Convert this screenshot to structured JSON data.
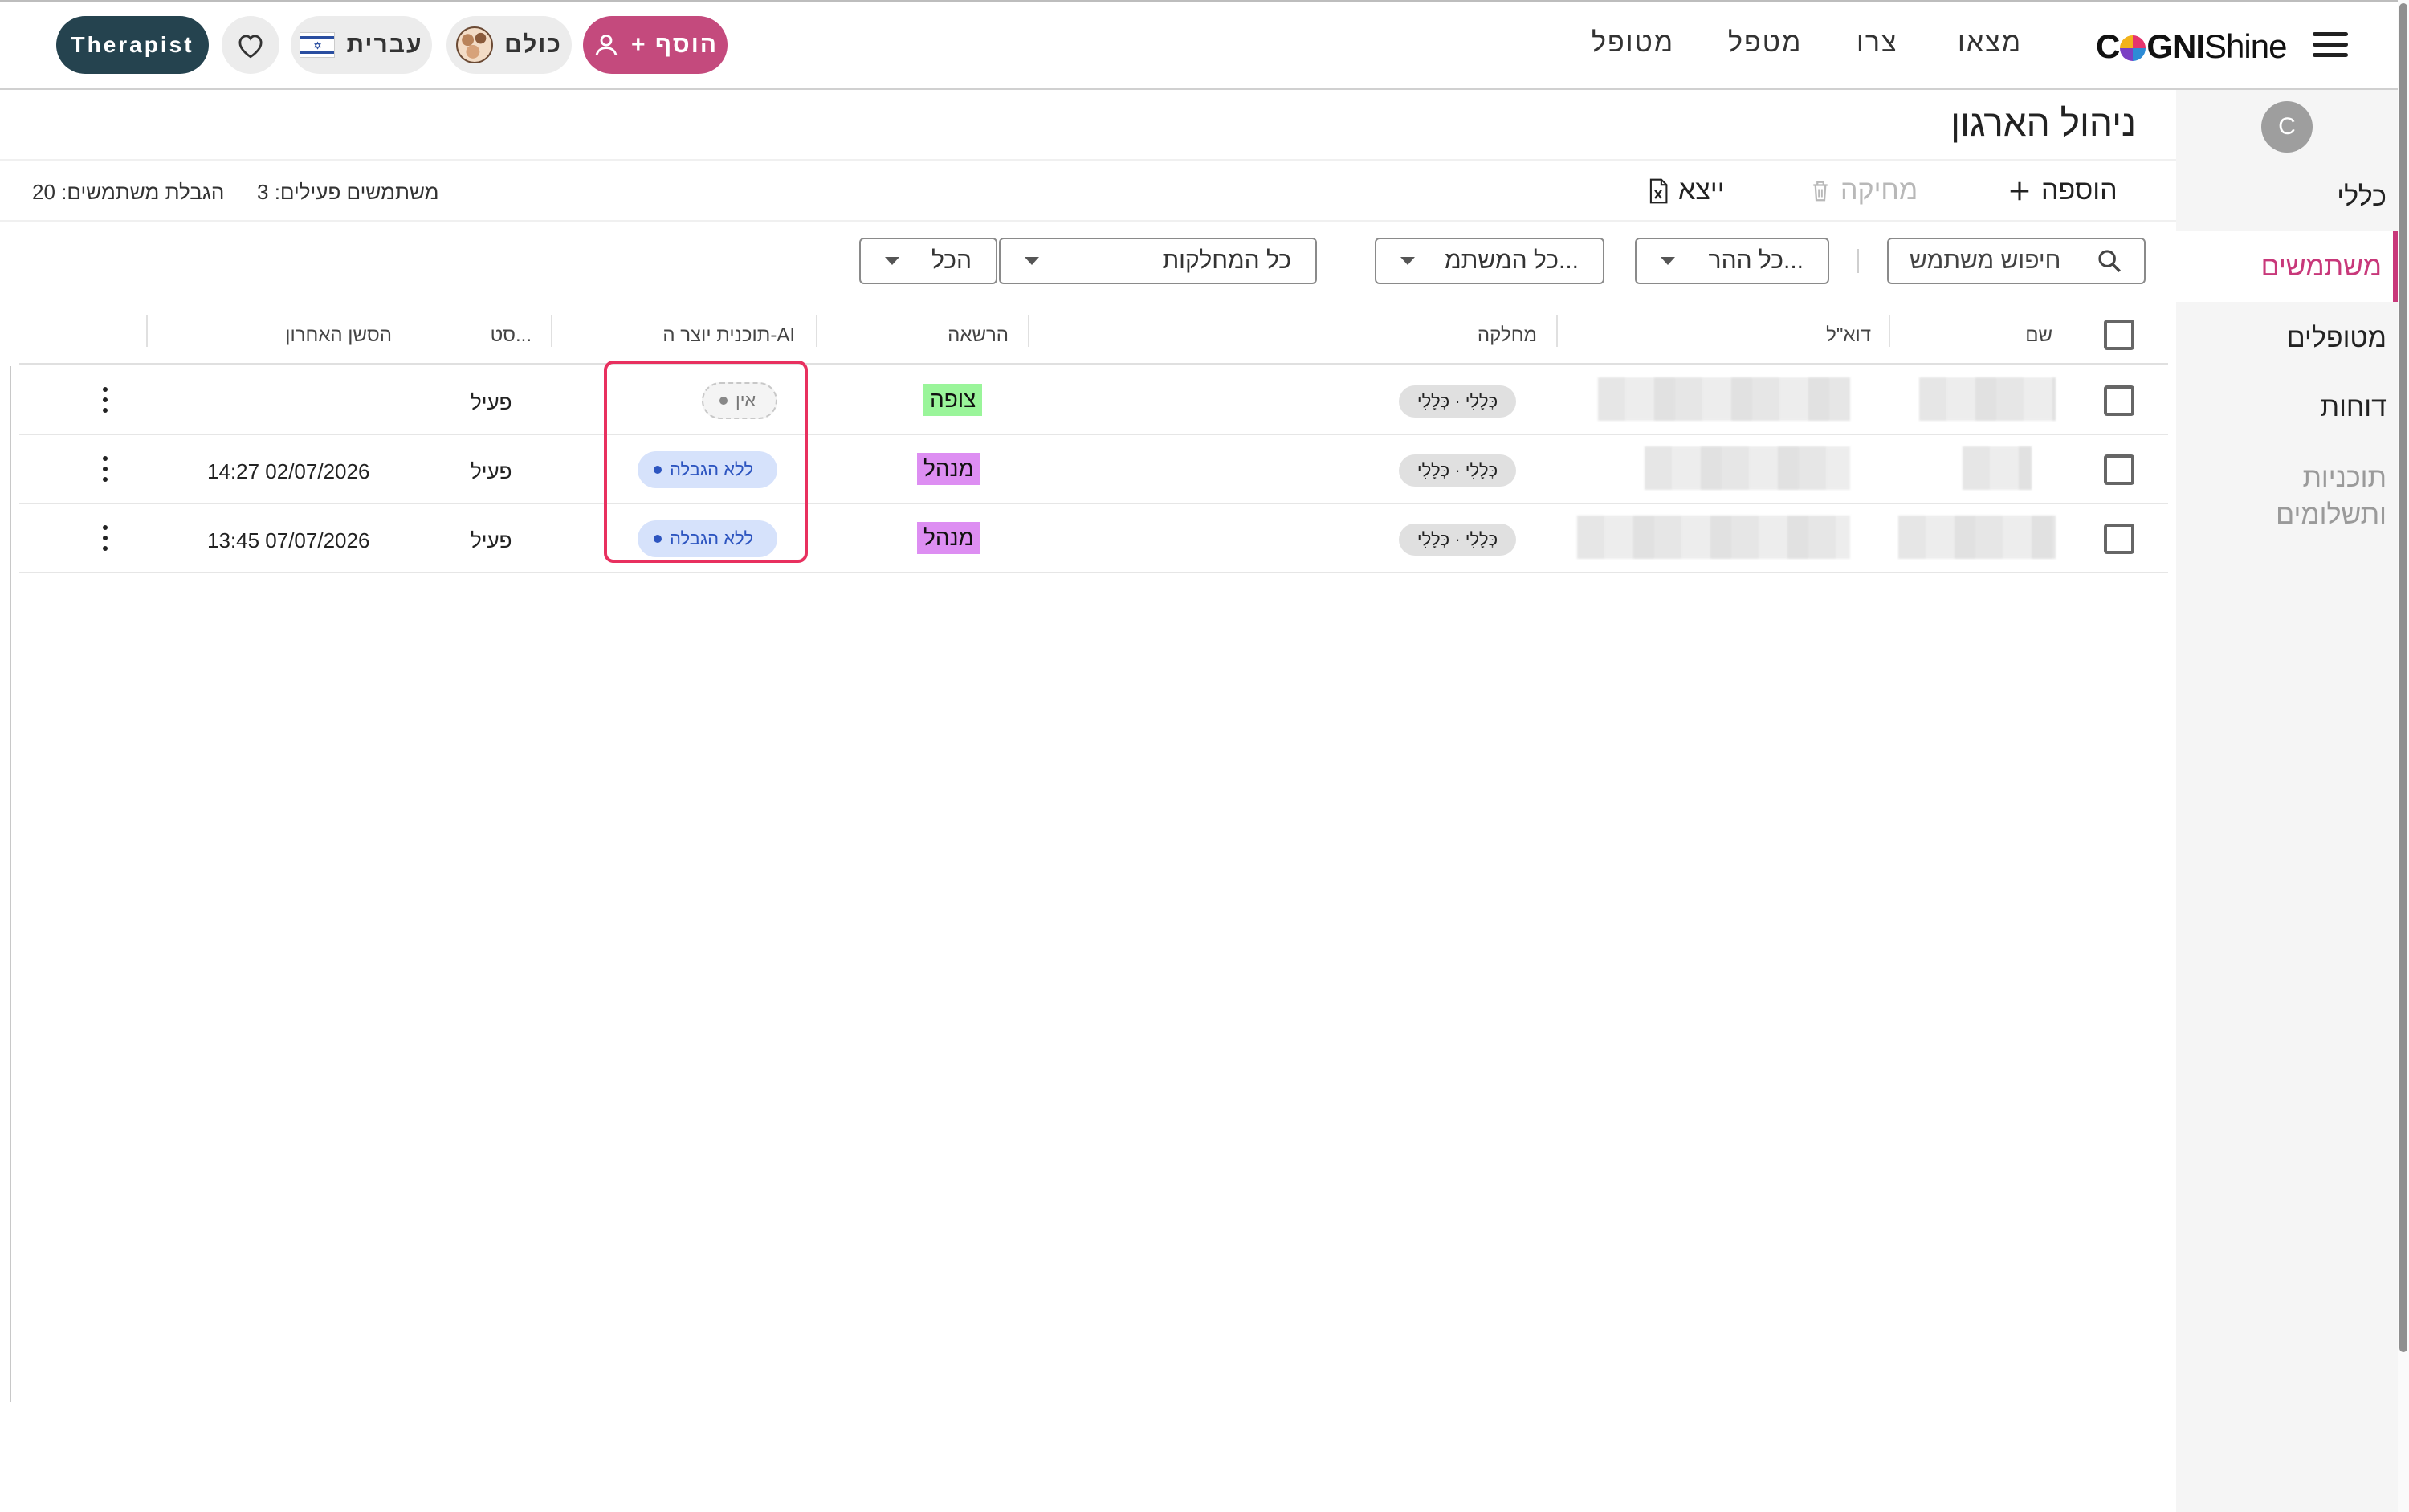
{
  "topbar": {
    "logo_bold": "CGNI",
    "logo_light": "Shine",
    "nav": [
      "מצאו",
      "צרו",
      "מטפל",
      "מטופל"
    ],
    "add_label": "+ הוסף",
    "everyone_label": "כולם",
    "language_label": "עברית",
    "role_label": "Therapist",
    "icons": [
      "menu-icon",
      "person-add-icon",
      "family-icon",
      "israel-flag-icon",
      "heart-icon"
    ],
    "accent": "#c44a7d",
    "dark": "#25434f"
  },
  "sidebar": {
    "avatar_initial": "C",
    "items": [
      {
        "label": "כללי"
      },
      {
        "label": "משתמשים"
      },
      {
        "label": "מטופלים"
      },
      {
        "label": "דוחות"
      },
      {
        "label_line1": "תוכניות",
        "label_line2": "ותשלומים"
      }
    ],
    "active_color": "#c8387a"
  },
  "main": {
    "title": "ניהול הארגון",
    "toolbar": {
      "add_label": "הוספה",
      "delete_label": "מחיקה",
      "export_label": "ייצא"
    },
    "stats": {
      "active_users": "משתמשים פעילים: 3",
      "user_limit": "הגבלת משתמשים: 20"
    },
    "filters": {
      "search_placeholder": "חיפוש משתמש",
      "permissions": "כל ההר...",
      "users": "כל המשתמ...",
      "departments": "כל המחלקות",
      "all": "הכל"
    }
  },
  "table": {
    "headers": {
      "name": "שם",
      "email": "דוא\"ל",
      "department": "מחלקה",
      "permission": "הרשאה",
      "ai_plan": "תוכנית יוצר ה-AI",
      "status": "סט...",
      "last_login": "הסשן האחרון"
    },
    "rows": [
      {
        "department": "כְּלָלִי · כְּלָלִי",
        "permission": "צופה",
        "ai_plan": "אין",
        "status": "פעיל",
        "last_login": ""
      },
      {
        "department": "כְּלָלִי · כְּלָלִי",
        "permission": "מנהל",
        "ai_plan": "ללא הגבלה",
        "status": "פעיל",
        "last_login": "14:27 02/07/2026"
      },
      {
        "department": "כְּלָלִי · כְּלָלִי",
        "permission": "מנהל",
        "ai_plan": "ללא הגבלה",
        "status": "פעיל",
        "last_login": "13:45 07/07/2026"
      }
    ],
    "colors": {
      "viewer": "#9af59a",
      "manager": "#dd8ef2",
      "unlimited_bg": "#d6e2fb",
      "unlimited_text": "#2d55c0",
      "highlight": "#e8305f"
    }
  }
}
